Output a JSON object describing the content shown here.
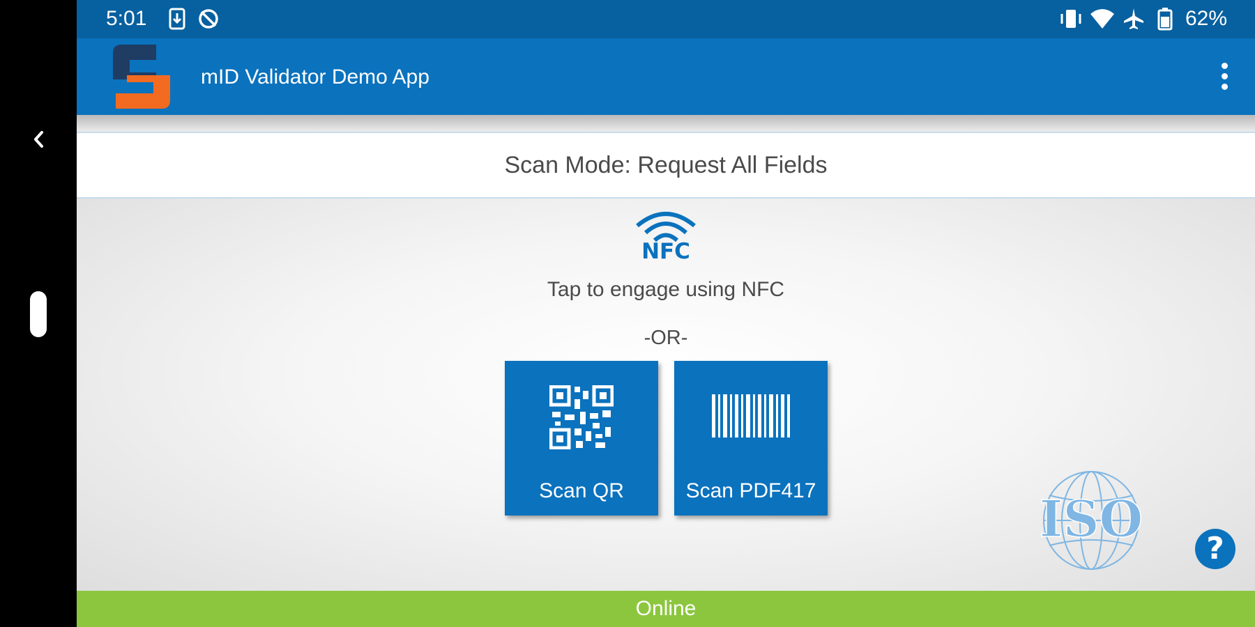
{
  "status_bar": {
    "time": "5:01",
    "battery_percent": "62%",
    "icons": [
      "sim-download-icon",
      "sync-off-icon",
      "vibrate-icon",
      "wifi-icon",
      "airplane-icon",
      "battery-icon"
    ]
  },
  "app_bar": {
    "title": "mID Validator Demo App",
    "logo_icon": "app-logo-icon",
    "menu_icon": "more-vert-icon"
  },
  "mode": {
    "text": "Scan Mode: Request All Fields"
  },
  "nfc": {
    "icon_label": "NFC",
    "caption": "Tap to engage using NFC"
  },
  "separator": "-OR-",
  "actions": {
    "scan_qr": "Scan QR",
    "scan_pdf417": "Scan PDF417"
  },
  "iso_logo_text": "ISO",
  "help_label": "?",
  "footer": {
    "status": "Online"
  },
  "colors": {
    "status_bar": "#07609f",
    "app_bar": "#0b72bd",
    "accent": "#0b72bd",
    "logo_dark": "#1f3c63",
    "logo_orange": "#f26b21",
    "online": "#8cc63f",
    "iso_blue": "#7fb6e3"
  }
}
